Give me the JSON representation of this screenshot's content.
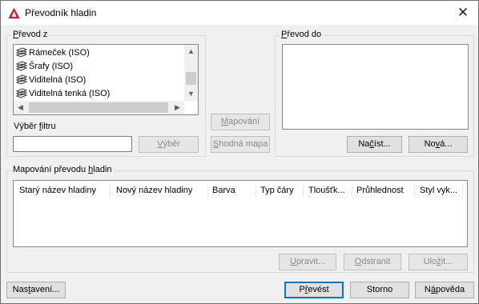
{
  "window": {
    "title": "Převodník hladin",
    "close_glyph": "✕",
    "accent": "#d71920"
  },
  "prevod_z": {
    "legend_pre": "",
    "legend_u": "P",
    "legend_post": "řevod z",
    "items": [
      {
        "label": "Rámeček (ISO)",
        "icon": "layer-stack-icon"
      },
      {
        "label": "Šrafy (ISO)",
        "icon": "layer-stack-icon"
      },
      {
        "label": "Viditelná (ISO)",
        "icon": "layer-stack-icon"
      },
      {
        "label": "Viditelná tenká (ISO)",
        "icon": "layer-stack-icon"
      }
    ],
    "scroll_up": "▲",
    "scroll_down": "▼",
    "scroll_left": "◀",
    "scroll_right": "▶"
  },
  "filter": {
    "label_pre": "Výběr ",
    "label_u": "f",
    "label_post": "iltru",
    "value": "",
    "select_pre": "",
    "select_u": "V",
    "select_post": "ýběr"
  },
  "middle": {
    "map_pre": "",
    "map_u": "M",
    "map_post": "apování",
    "same_pre": "",
    "same_u": "S",
    "same_post": "hodná mapa"
  },
  "prevod_do": {
    "legend_pre": "",
    "legend_u": "P",
    "legend_post": "řevod do",
    "load_pre": "Na",
    "load_u": "č",
    "load_post": "íst...",
    "new_pre": "No",
    "new_u": "v",
    "new_post": "á..."
  },
  "mapping": {
    "legend_pre": "Mapování převodu ",
    "legend_u": "h",
    "legend_post": "ladin",
    "columns": [
      "Starý název hladiny",
      "Nový název hladiny",
      "Barva",
      "Typ čáry",
      "Tloušťk...",
      "Průhlednost",
      "Styl vyk..."
    ],
    "edit_pre": "",
    "edit_u": "U",
    "edit_post": "pravit...",
    "remove_pre": "",
    "remove_u": "O",
    "remove_post": "dstranit",
    "save_pre": "Ulo",
    "save_u": "ž",
    "save_post": "it..."
  },
  "footer": {
    "settings_pre": "Nas",
    "settings_u": "t",
    "settings_post": "avení...",
    "convert_pre": "P",
    "convert_u": "ř",
    "convert_post": "evést",
    "cancel": "Storno",
    "help_pre": "N",
    "help_u": "á",
    "help_post": "pověda"
  }
}
